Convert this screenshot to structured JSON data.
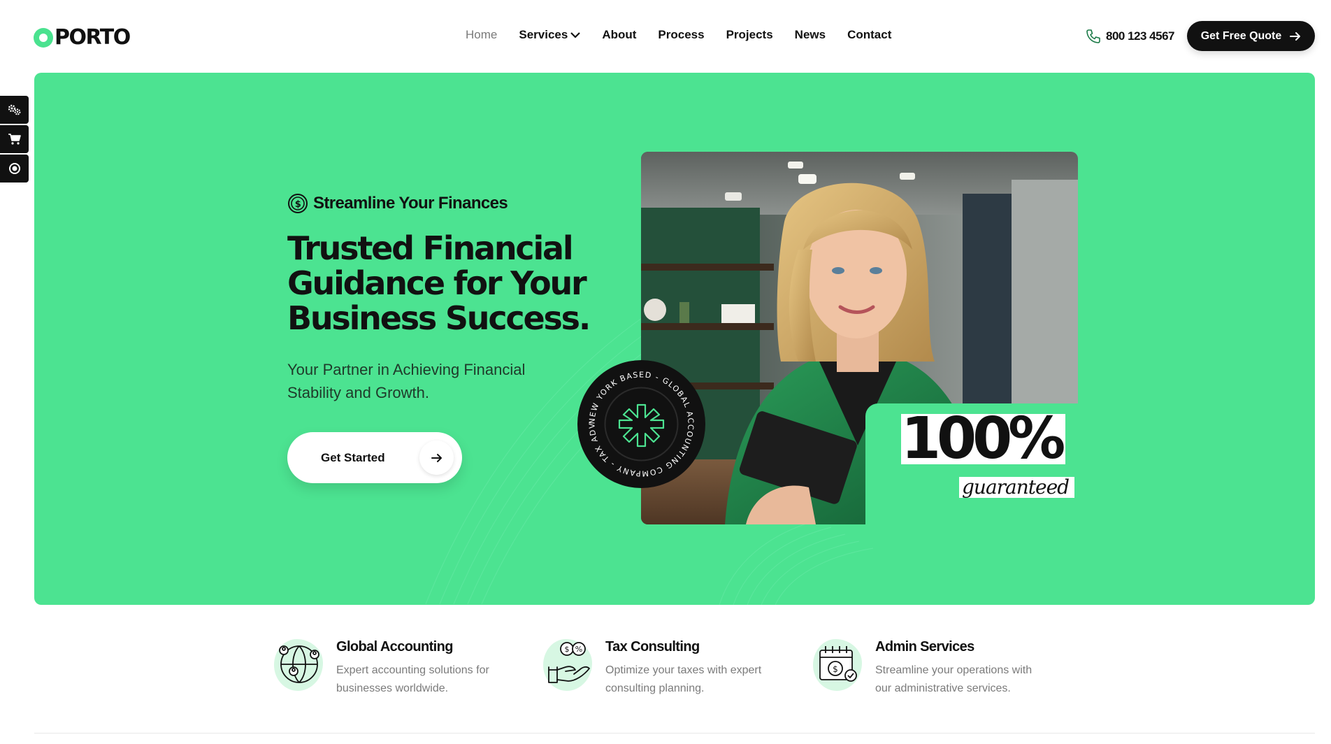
{
  "brand": {
    "logo_text": "PORTO",
    "accent_color": "#4ce391",
    "dark_color": "#111111"
  },
  "nav": {
    "items": [
      {
        "label": "Home",
        "active": true
      },
      {
        "label": "Services",
        "has_dropdown": true
      },
      {
        "label": "About"
      },
      {
        "label": "Process"
      },
      {
        "label": "Projects"
      },
      {
        "label": "News"
      },
      {
        "label": "Contact"
      }
    ]
  },
  "header": {
    "phone": "800 123 4567",
    "phone_icon": "phone-icon",
    "quote_button": "Get Free Quote"
  },
  "side_tools": [
    {
      "icon": "gears-icon"
    },
    {
      "icon": "cart-icon"
    },
    {
      "icon": "record-icon"
    }
  ],
  "hero": {
    "eyebrow": "Streamline Your Finances",
    "title_line1": "Trusted Financial",
    "title_line2": "Guidance for Your",
    "title_line3": "Business Success.",
    "subtitle": "Your Partner in Achieving Financial Stability and Growth.",
    "cta_label": "Get Started",
    "badge_text": "NEW YORK BASED - GLOBAL ACCOUNTING COMPANY - TAX ADVISOR -",
    "big_number": "100%",
    "guaranteed": "guaranteed"
  },
  "features": [
    {
      "title": "Global Accounting",
      "line1": "Expert accounting solutions for",
      "line2": "businesses worldwide.",
      "icon": "globe-people-icon"
    },
    {
      "title": "Tax Consulting",
      "line1": "Optimize your taxes with expert",
      "line2": "consulting planning.",
      "icon": "hand-coins-icon"
    },
    {
      "title": "Admin Services",
      "line1": "Streamline your operations with",
      "line2": "our administrative services.",
      "icon": "calendar-dollar-icon"
    }
  ]
}
